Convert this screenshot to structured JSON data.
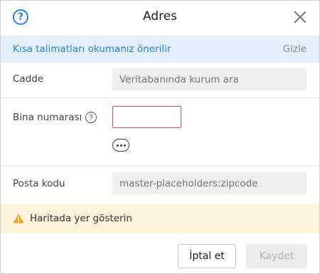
{
  "dialog": {
    "title": "Adres",
    "help_icon": "question-icon",
    "help_glyph": "?",
    "close_icon": "close-icon"
  },
  "hint": {
    "text": "Kısa talimatları okumanız önerilir",
    "hide_label": "Gizle"
  },
  "form": {
    "street": {
      "label": "Cadde",
      "placeholder": "Veritabanında kurum ara",
      "value": ""
    },
    "building": {
      "label": "Bina numarası",
      "info_icon": "info-question-icon",
      "info_glyph": "?",
      "value": "",
      "more_icon": "ellipsis-icon"
    },
    "postal": {
      "label": "Posta kodu",
      "placeholder": "master-placeholders:zipcode",
      "value": ""
    }
  },
  "map_warning": {
    "icon": "warning-icon",
    "text": "Haritada yer gösterin"
  },
  "buttons": {
    "cancel": "İptal et",
    "save": "Kaydet"
  },
  "colors": {
    "accent": "#2b82e6",
    "hint_bg": "#e3f0fb",
    "warning_bg": "#fdf3dc",
    "warning_icon": "#f0a020",
    "error_border": "#e05252"
  }
}
